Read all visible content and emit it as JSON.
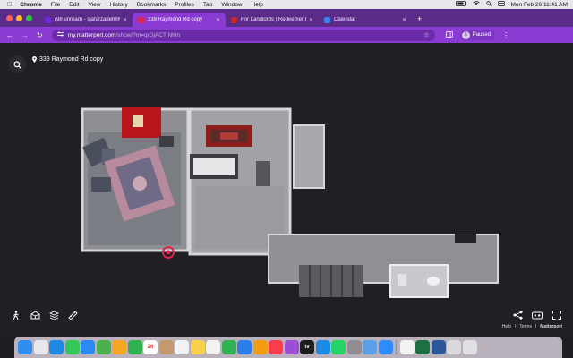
{
  "menubar": {
    "app": "Chrome",
    "items": [
      "File",
      "Edit",
      "View",
      "History",
      "Bookmarks",
      "Profiles",
      "Tab",
      "Window",
      "Help"
    ],
    "datetime": "Mon Feb 26  11:41 AM"
  },
  "tabs": [
    {
      "title": "(98 unread) - sjafarzadeh@...",
      "favicon_color": "#6d28d9",
      "active": false
    },
    {
      "title": "339 Raymond Rd copy",
      "favicon_color": "#e0244e",
      "active": true
    },
    {
      "title": "For Landlords | Redeemer Li...",
      "favicon_color": "#c62828",
      "active": false
    },
    {
      "title": "Calendar",
      "favicon_color": "#3b82f6",
      "active": false
    }
  ],
  "toolbar": {
    "url_host": "my.matterport.com",
    "url_path": "/show/?m=qrDjACTjNhm",
    "profile_label": "Paused",
    "profile_initial": "S"
  },
  "viewer": {
    "place_title": "339 Raymond Rd copy",
    "footer": {
      "help": "Help",
      "terms": "Terms",
      "brand": "Matterport"
    }
  },
  "colors": {
    "tab_strip": "#5b2b8a",
    "toolbar": "#8a3bd1",
    "viewer_bg": "#1f1f24",
    "rug_red": "#b7141b",
    "marker": "#e0244e"
  },
  "dock": {
    "apps": [
      {
        "name": "finder-icon",
        "color": "#2f8cf0",
        "label": ""
      },
      {
        "name": "launchpad-icon",
        "color": "#e8e8ec",
        "label": ""
      },
      {
        "name": "safari-icon",
        "color": "#1e88e5",
        "label": ""
      },
      {
        "name": "messages-icon",
        "color": "#34c759",
        "label": ""
      },
      {
        "name": "mail-icon",
        "color": "#2a89f5",
        "label": ""
      },
      {
        "name": "maps-icon",
        "color": "#4caf50",
        "label": ""
      },
      {
        "name": "photos-icon",
        "color": "#f5a623",
        "label": ""
      },
      {
        "name": "facetime-icon",
        "color": "#2fb14f",
        "label": ""
      },
      {
        "name": "calendar-icon",
        "color": "#ffffff",
        "label": "26"
      },
      {
        "name": "contacts-icon",
        "color": "#c49a6c",
        "label": ""
      },
      {
        "name": "reminders-icon",
        "color": "#f2f2f2",
        "label": ""
      },
      {
        "name": "notes-icon",
        "color": "#f7d14b",
        "label": ""
      },
      {
        "name": "chrome-icon",
        "color": "#f2f2f2",
        "label": ""
      },
      {
        "name": "numbers-icon",
        "color": "#2fb14f",
        "label": ""
      },
      {
        "name": "keynote-icon",
        "color": "#2b7de9",
        "label": ""
      },
      {
        "name": "pages-icon",
        "color": "#f39c12",
        "label": ""
      },
      {
        "name": "music-icon",
        "color": "#fa3c4c",
        "label": ""
      },
      {
        "name": "podcasts-icon",
        "color": "#9b4dd6",
        "label": ""
      },
      {
        "name": "tv-icon",
        "color": "#1c1c1e",
        "label": "tv"
      },
      {
        "name": "app-store-icon",
        "color": "#1e88e5",
        "label": ""
      },
      {
        "name": "whatsapp-icon",
        "color": "#25d366",
        "label": ""
      },
      {
        "name": "system-settings-icon",
        "color": "#8e8e93",
        "label": ""
      },
      {
        "name": "preview-icon",
        "color": "#5aa0e6",
        "label": ""
      },
      {
        "name": "zoom-icon",
        "color": "#2d8cff",
        "label": ""
      }
    ],
    "right_apps": [
      {
        "name": "drive-icon",
        "color": "#f2f2f2",
        "label": ""
      },
      {
        "name": "excel-icon",
        "color": "#1e7145",
        "label": ""
      },
      {
        "name": "word-icon",
        "color": "#2b579a",
        "label": ""
      },
      {
        "name": "downloads-icon",
        "color": "#d9d9de",
        "label": ""
      },
      {
        "name": "trash-icon",
        "color": "#e0e0e4",
        "label": ""
      }
    ]
  }
}
